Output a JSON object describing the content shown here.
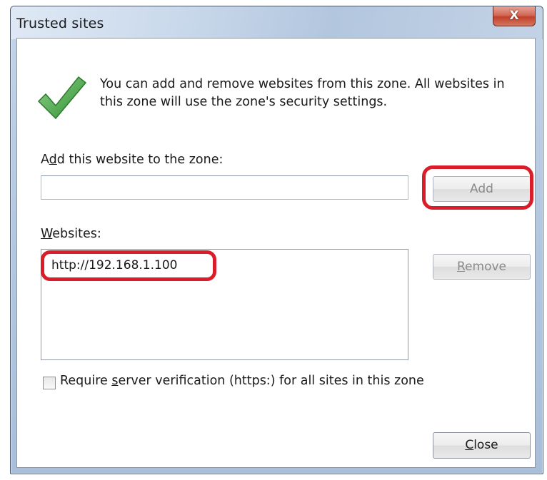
{
  "window": {
    "title": "Trusted sites",
    "close_glyph": "X"
  },
  "info": {
    "line1": "You can add and remove websites from this zone. All websites in",
    "line2": "this zone will use the zone's security settings."
  },
  "add_section": {
    "label_pre": "A",
    "label_access": "d",
    "label_post": "d this website to the zone:",
    "input_value": "",
    "add_button": "Add"
  },
  "sites_section": {
    "label_access": "W",
    "label_post": "ebsites:",
    "items": [
      "http://192.168.1.100"
    ],
    "remove_access": "R",
    "remove_post": "emove"
  },
  "require": {
    "checked": false,
    "pre": "Require ",
    "access": "s",
    "post": "erver verification (https:) for all sites in this zone"
  },
  "footer": {
    "close_access": "C",
    "close_post": "lose"
  },
  "icons": {
    "check": "green-checkmark-icon",
    "close": "close-icon"
  },
  "colors": {
    "highlight": "#d91e2a",
    "check_green": "#3aa33a"
  }
}
